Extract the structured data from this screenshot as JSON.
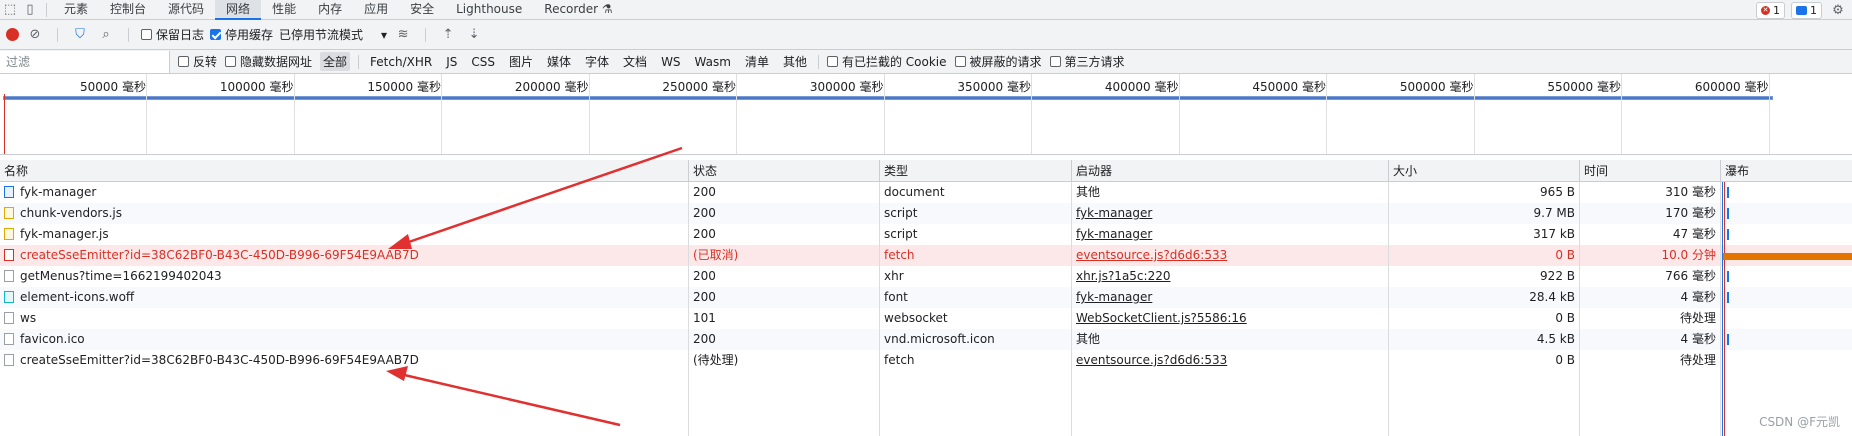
{
  "toolbar_tabs": [
    "元素",
    "控制台",
    "源代码",
    "网络",
    "性能",
    "内存",
    "应用",
    "安全",
    "Lighthouse",
    "Recorder"
  ],
  "active_tab": "网络",
  "badges": {
    "errors": "1",
    "messages": "1"
  },
  "network_toolbar": {
    "preserve_log": "保留日志",
    "disable_cache": "停用缓存",
    "throttle": "已停用节流模式"
  },
  "filter_bar": {
    "placeholder": "过滤",
    "invert": "反转",
    "hide_data_urls": "隐藏数据网址",
    "types": [
      "全部",
      "Fetch/XHR",
      "JS",
      "CSS",
      "图片",
      "媒体",
      "字体",
      "文档",
      "WS",
      "Wasm",
      "清单",
      "其他"
    ],
    "blocked_cookies": "有已拦截的 Cookie",
    "blocked_requests": "被屏蔽的请求",
    "third_party": "第三方请求"
  },
  "overview_ticks": [
    "50000 毫秒",
    "100000 毫秒",
    "150000 毫秒",
    "200000 毫秒",
    "250000 毫秒",
    "300000 毫秒",
    "350000 毫秒",
    "400000 毫秒",
    "450000 毫秒",
    "500000 毫秒",
    "550000 毫秒",
    "600000 毫秒",
    "65"
  ],
  "columns": {
    "name": "名称",
    "status": "状态",
    "type": "类型",
    "initiator": "启动器",
    "size": "大小",
    "time": "时间",
    "waterfall": "瀑布"
  },
  "rows": [
    {
      "name": "fyk-manager",
      "status": "200",
      "type": "document",
      "initiator": "其他",
      "initiator_link": false,
      "size": "965 B",
      "time": "310 毫秒",
      "icon": "doc"
    },
    {
      "name": "chunk-vendors.js",
      "status": "200",
      "type": "script",
      "initiator": "fyk-manager",
      "initiator_link": true,
      "size": "9.7 MB",
      "time": "170 毫秒",
      "icon": "js"
    },
    {
      "name": "fyk-manager.js",
      "status": "200",
      "type": "script",
      "initiator": "fyk-manager",
      "initiator_link": true,
      "size": "317 kB",
      "time": "47 毫秒",
      "icon": "js"
    },
    {
      "name": "createSseEmitter?id=38C62BF0-B43C-450D-B996-69F54E9AAB7D",
      "status": "(已取消)",
      "type": "fetch",
      "initiator": "eventsource.js?d6d6:533",
      "initiator_link": true,
      "size": "0 B",
      "time": "10.0 分钟",
      "icon": "err",
      "error": true
    },
    {
      "name": "getMenus?time=1662199402043",
      "status": "200",
      "type": "xhr",
      "initiator": "xhr.js?1a5c:220",
      "initiator_link": true,
      "size": "922 B",
      "time": "766 毫秒",
      "icon": "plain"
    },
    {
      "name": "element-icons.woff",
      "status": "200",
      "type": "font",
      "initiator": "fyk-manager",
      "initiator_link": true,
      "size": "28.4 kB",
      "time": "4 毫秒",
      "icon": "font"
    },
    {
      "name": "ws",
      "status": "101",
      "type": "websocket",
      "initiator": "WebSocketClient.js?5586:16",
      "initiator_link": true,
      "size": "0 B",
      "time": "待处理",
      "icon": "plain"
    },
    {
      "name": "favicon.ico",
      "status": "200",
      "type": "vnd.microsoft.icon",
      "initiator": "其他",
      "initiator_link": false,
      "size": "4.5 kB",
      "time": "4 毫秒",
      "icon": "plain"
    },
    {
      "name": "createSseEmitter?id=38C62BF0-B43C-450D-B996-69F54E9AAB7D",
      "status": "(待处理)",
      "type": "fetch",
      "initiator": "eventsource.js?d6d6:533",
      "initiator_link": true,
      "size": "0 B",
      "time": "待处理",
      "icon": "plain"
    }
  ],
  "watermark": "CSDN @F元凯"
}
